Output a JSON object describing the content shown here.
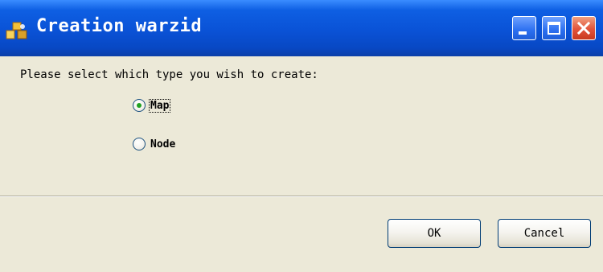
{
  "window": {
    "title": "Creation warzid",
    "icon": "wizard-app-icon",
    "controls": [
      "minimize-icon",
      "maximize-icon",
      "close-icon"
    ],
    "colors": {
      "titlebar": "#0A52D6",
      "close": "#E2533A",
      "background": "#ECE9D8"
    }
  },
  "prompt": "Please select which type you wish to create:",
  "options": [
    {
      "label": "Map",
      "selected": true
    },
    {
      "label": "Node",
      "selected": false
    }
  ],
  "buttons": {
    "ok_label": "OK",
    "cancel_label": "Cancel"
  }
}
